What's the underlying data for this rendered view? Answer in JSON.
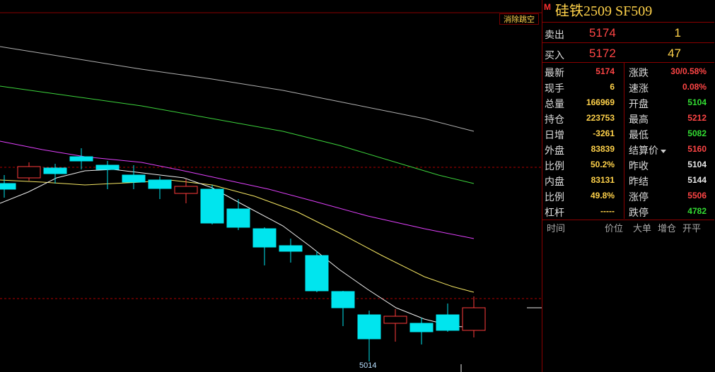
{
  "chart": {
    "clear_gap_label": "消除跳空",
    "low_label": "5014",
    "colors": {
      "up": "#ff3b3b",
      "down": "#00e5ee",
      "ma_white": "#f0f0f0",
      "ma_yellow": "#f5e663",
      "ma_magenta": "#e040fb",
      "ma_green": "#3cd43c",
      "ma_gray": "#b0b0b0"
    }
  },
  "quote": {
    "marker": "M",
    "title": "硅铁2509  SF509",
    "orderbook": [
      {
        "label": "卖出",
        "price": "5174",
        "volume": "1"
      },
      {
        "label": "买入",
        "price": "5172",
        "volume": "47"
      }
    ],
    "rows": [
      {
        "l1": "最新",
        "v1": "5174",
        "c1": "red",
        "l2": "涨跌",
        "v2": "30/0.58%",
        "c2": "red"
      },
      {
        "l1": "现手",
        "v1": "6",
        "c1": "yellow",
        "l2": "速涨",
        "v2": "0.08%",
        "c2": "red"
      },
      {
        "l1": "总量",
        "v1": "166969",
        "c1": "yellow",
        "l2": "开盘",
        "v2": "5104",
        "c2": "green"
      },
      {
        "l1": "持仓",
        "v1": "223753",
        "c1": "yellow",
        "l2": "最高",
        "v2": "5212",
        "c2": "red"
      },
      {
        "l1": "日增",
        "v1": "-3261",
        "c1": "yellow",
        "l2": "最低",
        "v2": "5082",
        "c2": "green"
      },
      {
        "l1": "外盘",
        "v1": "83839",
        "c1": "yellow",
        "l2": "结算价",
        "v2": "5160",
        "c2": "red"
      },
      {
        "l1": "比例",
        "v1": "50.2%",
        "c1": "yellow",
        "l2": "昨收",
        "v2": "5104",
        "c2": "white"
      },
      {
        "l1": "内盘",
        "v1": "83131",
        "c1": "yellow",
        "l2": "昨结",
        "v2": "5144",
        "c2": "white"
      },
      {
        "l1": "比例",
        "v1": "49.8%",
        "c1": "yellow",
        "l2": "涨停",
        "v2": "5506",
        "c2": "red"
      },
      {
        "l1": "杠杆",
        "v1": "-----",
        "c1": "yellow",
        "l2": "跌停",
        "v2": "4782",
        "c2": "green"
      }
    ],
    "tick_headers": [
      "时间",
      "价位",
      "大单",
      "增仓",
      "开平"
    ]
  }
}
